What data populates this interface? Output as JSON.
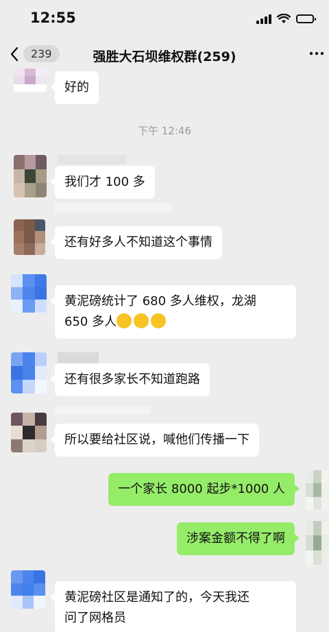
{
  "status_bar": {
    "time": "12:55"
  },
  "nav": {
    "back_count": "239",
    "title": "强胜大石坝维权群(259)"
  },
  "chat": {
    "timestamp": "下午 12:46",
    "messages": [
      {
        "text": "好的",
        "side": "left"
      },
      {
        "text": "我们才 100 多",
        "side": "left"
      },
      {
        "text": "还有好多人不知道这个事情",
        "side": "left"
      },
      {
        "text": "黄泥磅统计了 680 多人维权，龙湖",
        "text2": "650 多人",
        "side": "left"
      },
      {
        "text": "还有很多家长不知道跑路",
        "side": "left"
      },
      {
        "text": "所以要给社区说，喊他们传播一下",
        "side": "left"
      },
      {
        "text": "一个家长 8000 起步*1000 人",
        "side": "right"
      },
      {
        "text": "涉案金额不得了啊",
        "side": "right"
      },
      {
        "text": "黄泥磅社区是通知了的，今天我还",
        "text2": "问了网格员",
        "side": "left"
      }
    ]
  }
}
